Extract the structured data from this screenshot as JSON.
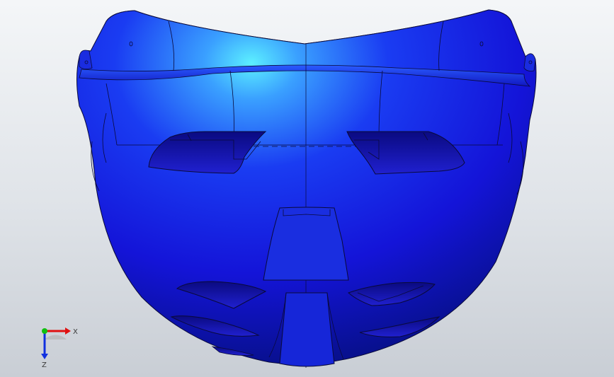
{
  "viewport": {
    "background_top": "#f4f6f8",
    "background_bottom": "#c9ced5"
  },
  "model": {
    "part_name": "face-mask",
    "body_color": "#1a1ae6",
    "highlight_color": "#5cf0ff",
    "shadow_color": "#050a8a",
    "edge_color": "#0a0a3a"
  },
  "triad": {
    "x_label": "X",
    "z_label": "Z",
    "x_color": "#e01010",
    "y_color": "#10c010",
    "z_color": "#1030e0"
  }
}
